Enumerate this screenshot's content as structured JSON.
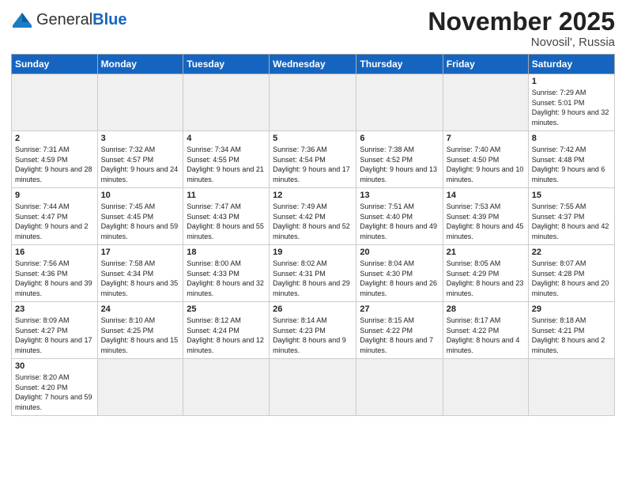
{
  "header": {
    "logo_general": "General",
    "logo_blue": "Blue",
    "month_title": "November 2025",
    "location": "Novosil', Russia"
  },
  "weekdays": [
    "Sunday",
    "Monday",
    "Tuesday",
    "Wednesday",
    "Thursday",
    "Friday",
    "Saturday"
  ],
  "weeks": [
    [
      {
        "day": "",
        "info": ""
      },
      {
        "day": "",
        "info": ""
      },
      {
        "day": "",
        "info": ""
      },
      {
        "day": "",
        "info": ""
      },
      {
        "day": "",
        "info": ""
      },
      {
        "day": "",
        "info": ""
      },
      {
        "day": "1",
        "info": "Sunrise: 7:29 AM\nSunset: 5:01 PM\nDaylight: 9 hours\nand 32 minutes."
      }
    ],
    [
      {
        "day": "2",
        "info": "Sunrise: 7:31 AM\nSunset: 4:59 PM\nDaylight: 9 hours\nand 28 minutes."
      },
      {
        "day": "3",
        "info": "Sunrise: 7:32 AM\nSunset: 4:57 PM\nDaylight: 9 hours\nand 24 minutes."
      },
      {
        "day": "4",
        "info": "Sunrise: 7:34 AM\nSunset: 4:55 PM\nDaylight: 9 hours\nand 21 minutes."
      },
      {
        "day": "5",
        "info": "Sunrise: 7:36 AM\nSunset: 4:54 PM\nDaylight: 9 hours\nand 17 minutes."
      },
      {
        "day": "6",
        "info": "Sunrise: 7:38 AM\nSunset: 4:52 PM\nDaylight: 9 hours\nand 13 minutes."
      },
      {
        "day": "7",
        "info": "Sunrise: 7:40 AM\nSunset: 4:50 PM\nDaylight: 9 hours\nand 10 minutes."
      },
      {
        "day": "8",
        "info": "Sunrise: 7:42 AM\nSunset: 4:48 PM\nDaylight: 9 hours\nand 6 minutes."
      }
    ],
    [
      {
        "day": "9",
        "info": "Sunrise: 7:44 AM\nSunset: 4:47 PM\nDaylight: 9 hours\nand 2 minutes."
      },
      {
        "day": "10",
        "info": "Sunrise: 7:45 AM\nSunset: 4:45 PM\nDaylight: 8 hours\nand 59 minutes."
      },
      {
        "day": "11",
        "info": "Sunrise: 7:47 AM\nSunset: 4:43 PM\nDaylight: 8 hours\nand 55 minutes."
      },
      {
        "day": "12",
        "info": "Sunrise: 7:49 AM\nSunset: 4:42 PM\nDaylight: 8 hours\nand 52 minutes."
      },
      {
        "day": "13",
        "info": "Sunrise: 7:51 AM\nSunset: 4:40 PM\nDaylight: 8 hours\nand 49 minutes."
      },
      {
        "day": "14",
        "info": "Sunrise: 7:53 AM\nSunset: 4:39 PM\nDaylight: 8 hours\nand 45 minutes."
      },
      {
        "day": "15",
        "info": "Sunrise: 7:55 AM\nSunset: 4:37 PM\nDaylight: 8 hours\nand 42 minutes."
      }
    ],
    [
      {
        "day": "16",
        "info": "Sunrise: 7:56 AM\nSunset: 4:36 PM\nDaylight: 8 hours\nand 39 minutes."
      },
      {
        "day": "17",
        "info": "Sunrise: 7:58 AM\nSunset: 4:34 PM\nDaylight: 8 hours\nand 35 minutes."
      },
      {
        "day": "18",
        "info": "Sunrise: 8:00 AM\nSunset: 4:33 PM\nDaylight: 8 hours\nand 32 minutes."
      },
      {
        "day": "19",
        "info": "Sunrise: 8:02 AM\nSunset: 4:31 PM\nDaylight: 8 hours\nand 29 minutes."
      },
      {
        "day": "20",
        "info": "Sunrise: 8:04 AM\nSunset: 4:30 PM\nDaylight: 8 hours\nand 26 minutes."
      },
      {
        "day": "21",
        "info": "Sunrise: 8:05 AM\nSunset: 4:29 PM\nDaylight: 8 hours\nand 23 minutes."
      },
      {
        "day": "22",
        "info": "Sunrise: 8:07 AM\nSunset: 4:28 PM\nDaylight: 8 hours\nand 20 minutes."
      }
    ],
    [
      {
        "day": "23",
        "info": "Sunrise: 8:09 AM\nSunset: 4:27 PM\nDaylight: 8 hours\nand 17 minutes."
      },
      {
        "day": "24",
        "info": "Sunrise: 8:10 AM\nSunset: 4:25 PM\nDaylight: 8 hours\nand 15 minutes."
      },
      {
        "day": "25",
        "info": "Sunrise: 8:12 AM\nSunset: 4:24 PM\nDaylight: 8 hours\nand 12 minutes."
      },
      {
        "day": "26",
        "info": "Sunrise: 8:14 AM\nSunset: 4:23 PM\nDaylight: 8 hours\nand 9 minutes."
      },
      {
        "day": "27",
        "info": "Sunrise: 8:15 AM\nSunset: 4:22 PM\nDaylight: 8 hours\nand 7 minutes."
      },
      {
        "day": "28",
        "info": "Sunrise: 8:17 AM\nSunset: 4:22 PM\nDaylight: 8 hours\nand 4 minutes."
      },
      {
        "day": "29",
        "info": "Sunrise: 8:18 AM\nSunset: 4:21 PM\nDaylight: 8 hours\nand 2 minutes."
      }
    ],
    [
      {
        "day": "30",
        "info": "Sunrise: 8:20 AM\nSunset: 4:20 PM\nDaylight: 7 hours\nand 59 minutes."
      },
      {
        "day": "",
        "info": ""
      },
      {
        "day": "",
        "info": ""
      },
      {
        "day": "",
        "info": ""
      },
      {
        "day": "",
        "info": ""
      },
      {
        "day": "",
        "info": ""
      },
      {
        "day": "",
        "info": ""
      }
    ]
  ]
}
